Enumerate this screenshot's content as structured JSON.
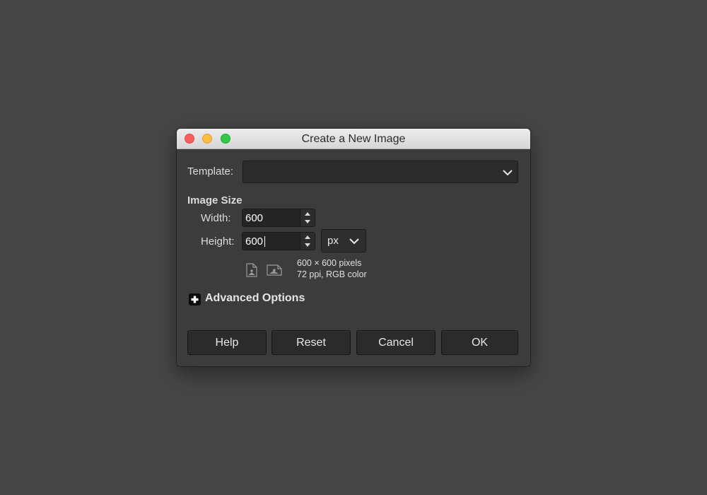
{
  "window": {
    "title": "Create a New Image"
  },
  "template": {
    "label": "Template:",
    "value": ""
  },
  "image_size": {
    "section_title": "Image Size",
    "width_label": "Width:",
    "width_value": "600",
    "height_label": "Height:",
    "height_value": "600",
    "unit": "px",
    "info_line1": "600 × 600 pixels",
    "info_line2": "72 ppi, RGB color"
  },
  "advanced": {
    "label": "Advanced Options"
  },
  "buttons": {
    "help": "Help",
    "reset": "Reset",
    "cancel": "Cancel",
    "ok": "OK"
  },
  "colors": {
    "desktop": "#464646",
    "dialog_bg": "#3c3c3c",
    "close": "#fc605c",
    "minimize": "#fdbc40",
    "zoom": "#34c84a"
  },
  "icons": {
    "portrait": "portrait-orientation-icon",
    "landscape": "landscape-orientation-icon",
    "expander": "plus-icon"
  }
}
